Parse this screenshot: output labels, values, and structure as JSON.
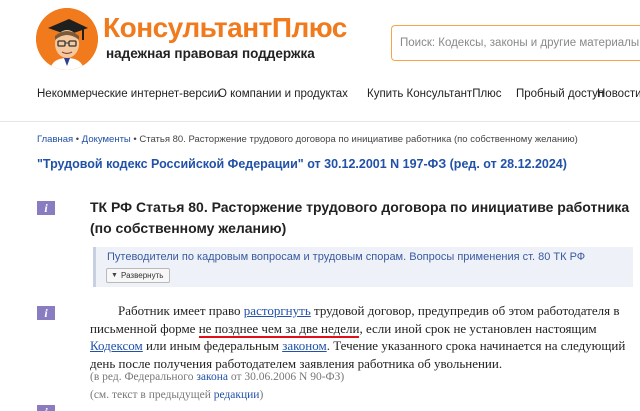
{
  "header": {
    "brand_title": "КонсультантПлюс",
    "brand_subtitle": "надежная правовая поддержка",
    "search_placeholder": "Поиск: Кодексы, законы и другие материалы",
    "accent_color": "#f07a1c"
  },
  "nav": {
    "items": [
      {
        "label": "Некоммерческие интернет-версии"
      },
      {
        "label": "О компании и продуктах"
      },
      {
        "label": "Купить КонсультантПлюс"
      },
      {
        "label": "Пробный доступ"
      },
      {
        "label": "Новости"
      }
    ]
  },
  "breadcrumb": {
    "home": "Главная",
    "sep": " • ",
    "docs": "Документы",
    "current": "Статья 80. Расторжение трудового договора по инициативе работника (по собственному желанию)"
  },
  "document": {
    "title": "\"Трудовой кодекс Российской Федерации\" от 30.12.2001 N 197-ФЗ (ред. от 28.12.2024)",
    "article_title": "ТК РФ Статья 80. Расторжение трудового договора по инициативе работника (по собственному желанию)",
    "guide_text": "Путеводители по кадровым вопросам и трудовым спорам. Вопросы применения ст. 80 ТК РФ",
    "expand_label": "Развернуть",
    "info_icon": "i",
    "para": {
      "t1": "Работник имеет право ",
      "link1": "расторгнуть",
      "t2": " трудовой договор, предупредив об этом работодателя в письменной форме ",
      "highlight": "не позднее чем за две недели",
      "t3": ", если иной срок не установлен настоящим ",
      "link2": "Кодексом",
      "t4": " или иным федеральным ",
      "link3": "законом",
      "t5": ". Течение указанного срока начинается на следующий день после получения работодателем заявления работника об увольнении."
    },
    "note1": {
      "pre": "(в ред. Федерального ",
      "link": "закона",
      "post": " от 30.06.2006 N 90-ФЗ)"
    },
    "note2": {
      "pre": "(см. текст в предыдущей ",
      "link": "редакции",
      "post": ")"
    }
  }
}
